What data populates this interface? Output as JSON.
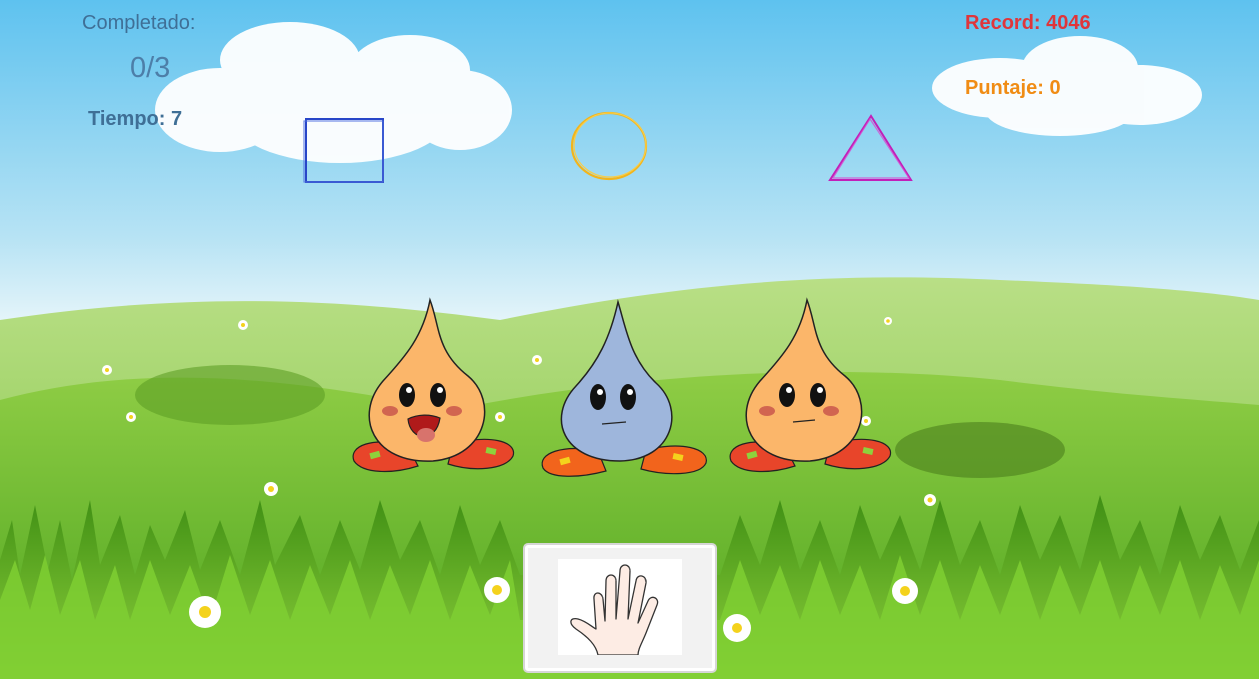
{
  "hud": {
    "completed_label": "Completado:",
    "completed_value": "0/3",
    "time_text": "Tiempo: 7",
    "record_text": "Record: 4046",
    "score_text": "Puntaje: 0"
  },
  "targets": [
    {
      "shape": "square",
      "color": "#2846c8"
    },
    {
      "shape": "circle",
      "color": "#f2b51c"
    },
    {
      "shape": "triangle",
      "color": "#c21fb9"
    }
  ],
  "characters": [
    {
      "color": "orange",
      "expression": "happy-open-mouth"
    },
    {
      "color": "blue",
      "expression": "neutral"
    },
    {
      "color": "orange",
      "expression": "neutral"
    }
  ],
  "hand_card": {
    "icon": "open-hand-five-fingers-icon"
  },
  "colors": {
    "sky_top": "#61c3ef",
    "grass": "#6cbc2b",
    "record": "#e0353b",
    "score": "#f08c14",
    "hud_text": "#3f6f96"
  }
}
